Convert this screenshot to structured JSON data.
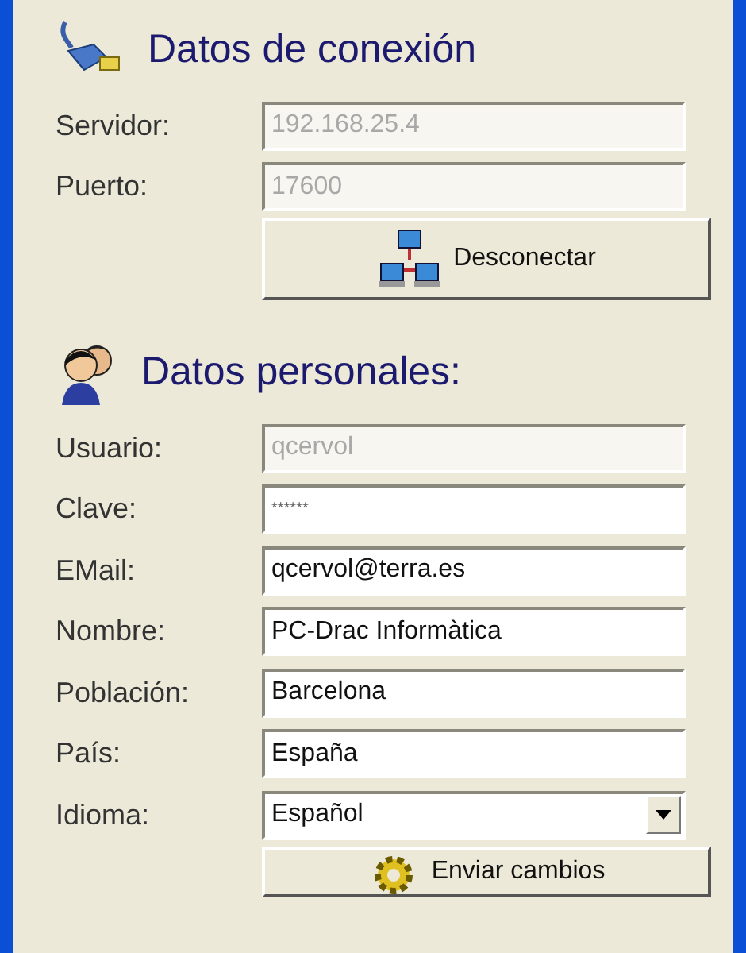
{
  "connection": {
    "title": "Datos de conexión",
    "fields": [
      {
        "label": "Servidor:",
        "kind": "text",
        "value": "192.168.25.4",
        "disabled": true
      },
      {
        "label": "Puerto:",
        "kind": "text",
        "value": "17600",
        "disabled": true
      }
    ],
    "button": "Desconectar"
  },
  "personal": {
    "title": "Datos personales:",
    "fields": [
      {
        "label": "Usuario:",
        "kind": "text",
        "value": "qcervol",
        "disabled": true
      },
      {
        "label": "Clave:",
        "kind": "password",
        "value": "******",
        "disabled": false
      },
      {
        "label": "EMail:",
        "kind": "text",
        "value": "qcervol@terra.es",
        "disabled": false
      },
      {
        "label": "Nombre:",
        "kind": "text",
        "value": "PC-Drac Informàtica",
        "disabled": false
      },
      {
        "label": "Población:",
        "kind": "text",
        "value": "Barcelona",
        "disabled": false
      },
      {
        "label": "País:",
        "kind": "text",
        "value": "España",
        "disabled": false
      },
      {
        "label": "Idioma:",
        "kind": "select",
        "value": "Español",
        "disabled": false
      }
    ],
    "button": "Enviar cambios"
  }
}
